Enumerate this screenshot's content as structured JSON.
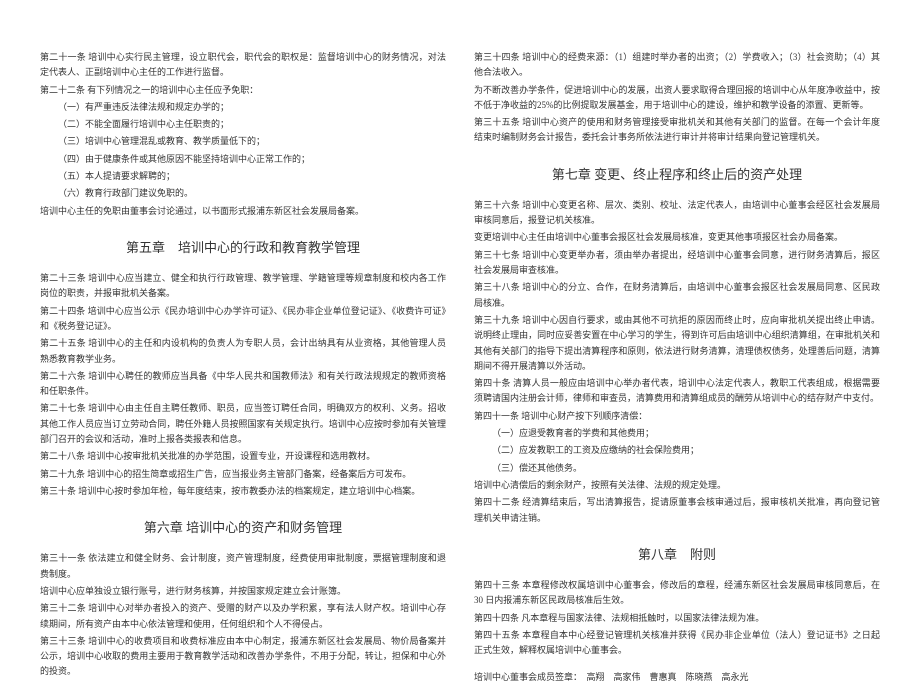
{
  "left": {
    "p1": "第二十一条 培训中心实行民主管理，设立职代会，职代会的职权是：监督培训中心的财务情况，对法定代表人、正副培训中心主任的工作进行监督。",
    "p2": "第二十二条 有下列情况之一的培训中心主任应予免职：",
    "p2a": "（一）有严重违反法律法规和规定办学的；",
    "p2b": "（二）不能全面履行培训中心主任职责的；",
    "p2c": "（三）培训中心管理混乱或教育、教学质量低下的；",
    "p2d": "（四）由于健康条件或其他原因不能坚持培训中心正常工作的；",
    "p2e": "（五）本人提请要求解聘的；",
    "p2f": "（六）教育行政部门建议免职的。",
    "p3": "培训中心主任的免职由董事会讨论通过，以书面形式报浦东新区社会发展局备案。",
    "ch5": "第五章　培训中心的行政和教育教学管理",
    "p4": "第二十三条 培训中心应当建立、健全和执行行政管理、教学管理、学籍管理等规章制度和校内各工作岗位的职责，并报审批机关备案。",
    "p5": "第二十四条 培训中心应当公示《民办培训中心办学许可证》、《民办非企业单位登记证》、《收费许可证》和《税务登记证》。",
    "p6": "第二十五条 培训中心的主任和内设机构的负责人为专职人员，会计出纳具有从业资格，其他管理人员熟悉教育教学业务。",
    "p7": "第二十六条 培训中心聘任的教师应当具备《中华人民共和国教师法》和有关行政法规规定的教师资格和任职条件。",
    "p8": "第二十七条 培训中心由主任自主聘任教师、职员，应当签订聘任合同，明确双方的权利、义务。招收其他工作人员应当订立劳动合同，聘任外籍人员按照国家有关规定执行。培训中心应按时参加有关管理部门召开的会议和活动，准时上报各类报表和信息。",
    "p9": "第二十八条 培训中心按审批机关批准的办学范围，设置专业，开设课程和选用教材。",
    "p10": "第二十九条 培训中心的招生简章或招生广告，应当报业务主管部门备案，经备案后方可发布。",
    "p11": "第三十条 培训中心按时参加年检，每年度结束，按市教委办法的档案规定，建立培训中心档案。",
    "ch6": "第六章 培训中心的资产和财务管理",
    "p12": "第三十一条 依法建立和健全财务、会计制度，资产管理制度，经费使用审批制度，票据管理制度和退费制度。",
    "p13": "培训中心应单独设立银行账号，进行财务核算，并按国家规定建立会计账簿。",
    "p14": "第三十二条 培训中心对举办者投入的资产、受赠的财产以及办学积累，享有法人财产权。培训中心存续期间，所有资产由本中心依法管理和使用，任何组织和个人不得侵占。",
    "p15": "第三十三条 培训中心的收费项目和收费标准应由本中心制定，报浦东新区社会发展局、物价局备案并公示，培训中心收取的费用主要用于教育教学活动和改善办学条件，不用于分配，转让，担保和中心外的投资。"
  },
  "right": {
    "p1": "第三十四条 培训中心的经费来源：（1）组建时举办者的出资；（2）学费收入；（3）社会资助；（4）其他合法收入。",
    "p2": "为不断改善办学条件，促进培训中心的发展，出资人要求取得合理回报的培训中心从年度净收益中，按不低于净收益的25%的比例提取发展基金，用于培训中心的建设，维护和教学设备的添置、更新等。",
    "p3": "第三十五条 培训中心资产的使用和财务管理接受审批机关和其他有关部门的监督。在每一个会计年度结束时编制财务会计报告，委托会计事务所依法进行审计并将审计结果向登记管理机关。",
    "ch7": "第七章 变更、终止程序和终止后的资产处理",
    "p4": "第三十六条 培训中心变更名称、层次、类别、校址、法定代表人，由培训中心董事会经区社会发展局审核同意后，报登记机关核准。",
    "p5": "变更培训中心主任由培训中心董事会报区社会发展局核准，变更其他事项报区社会办局备案。",
    "p6": "第三十七条 培训中心变更举办者，须由举办者提出，经培训中心董事会同意，进行财务清算后，报区社会发展局审查核准。",
    "p7": "第三十八条 培训中心的分立、合作，在财务清算后，由培训中心董事会报区社会发展局同意、区民政局核准。",
    "p8": "第三十九条 培训中心因自行要求，或由其他不可抗拒的原因而终止时，应向审批机关提出终止申请。说明终止理由，同时应妥善安置在中心学习的学生，得到许可后由培训中心组织清算组，在审批机关和其他有关部门的指导下提出清算程序和原则，依法进行财务清算，清理债权债务，处理善后问题，清算期间不得开展清算以外活动。",
    "p9": "第四十条 清算人员一般应由培训中心举办者代表，培训中心法定代表人，教职工代表组成，根据需要须聘请国内注册会计师，律师和审查员，清算费用和清算组成员的酬劳从培训中心的结存财产中支付。",
    "p10": "第四十一条 培训中心财产按下列顺序清偿：",
    "p10a": "（一）应退受教育者的学费和其他费用；",
    "p10b": "（二）应发教职工的工资及应缴纳的社会保险费用；",
    "p10c": "（三）偿还其他债务。",
    "p11": "培训中心清偿后的剩余财产，按照有关法律、法规的规定处理。",
    "p12": "第四十二条 经清算结束后，写出清算报告，提请原董事会核审通过后，报审核机关批准，再向登记管理机关申请注销。",
    "ch8": "第八章　附则",
    "p13": "第四十三条 本章程修改权属培训中心董事会，修改后的章程，经浦东新区社会发展局审核同意后，在 30 日内报浦东新区民政局核准后生效。",
    "p14": "第四十四条 凡本章程与国家法律、法规相抵触时，以国家法律法规为准。",
    "p15": "第四十五条 本章程自本中心经登记管理机关核准并获得《民办非企业单位（法人）登记证书》之日起正式生效，解释权属培训中心董事会。",
    "p16": "培训中心董事会成员签章：　高翔　高家伟　曹惠真　陈晓燕　高永光"
  }
}
